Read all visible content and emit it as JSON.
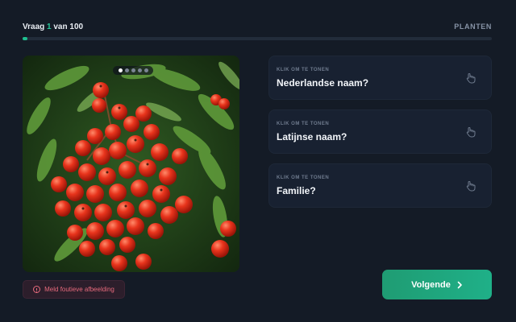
{
  "progress": {
    "prefix": "Vraag",
    "current": "1",
    "middle": "van",
    "total": "100",
    "fraction": 0.01
  },
  "category": "PLANTEN",
  "image": {
    "subject": "red berry cluster (rowan) with green leaves",
    "carousel_count": 5,
    "carousel_active": 0
  },
  "report_button": {
    "label": "Meld foutieve afbeelding",
    "icon": "alert-circle-icon"
  },
  "cards": [
    {
      "hint": "KLIK OM TE TONEN",
      "question": "Nederlandse naam?",
      "icon": "hand-pointer-icon"
    },
    {
      "hint": "KLIK OM TE TONEN",
      "question": "Latijnse naam?",
      "icon": "hand-pointer-icon"
    },
    {
      "hint": "KLIK OM TE TONEN",
      "question": "Familie?",
      "icon": "hand-pointer-icon"
    }
  ],
  "next_button": {
    "label": "Volgende",
    "icon": "chevron-right-icon"
  },
  "colors": {
    "background": "#141b26",
    "accent": "#1fbf8f",
    "card": "#182131",
    "danger": "#e66a7c"
  }
}
